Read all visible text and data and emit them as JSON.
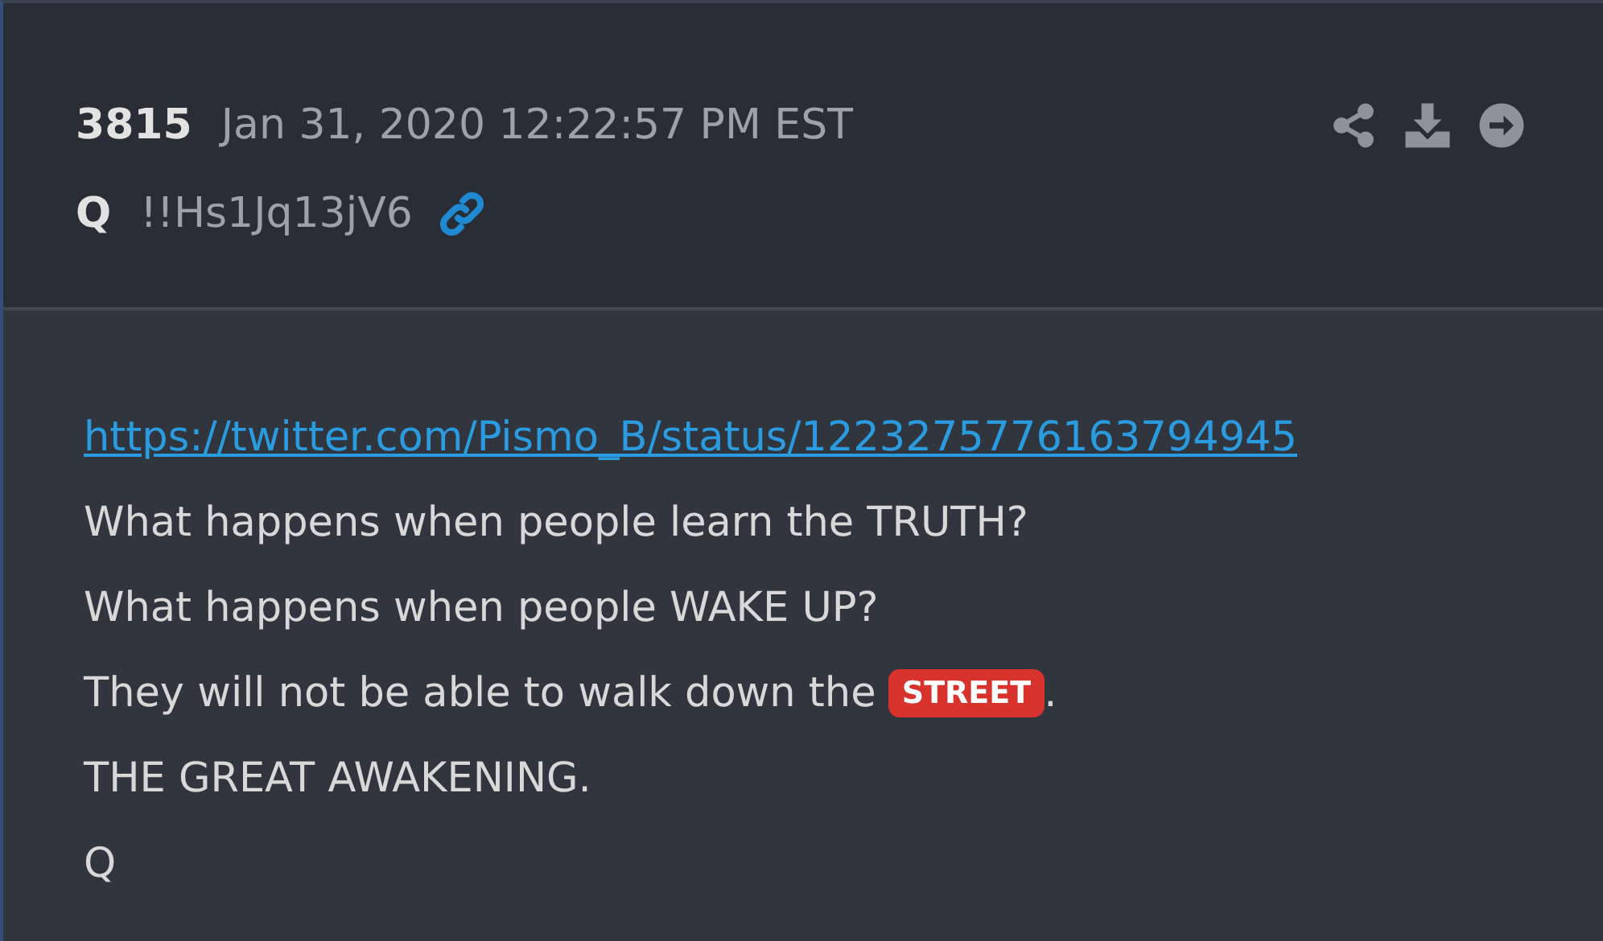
{
  "post": {
    "number": "3815",
    "date": "Jan 31, 2020 12:22:57 PM EST",
    "author": "Q",
    "tripcode": "!!Hs1Jq13jV6",
    "actions": [
      {
        "kind": "share"
      },
      {
        "kind": "download"
      },
      {
        "kind": "open"
      }
    ],
    "lines": [
      {
        "parts": [
          {
            "kind": "link",
            "text": "https://twitter.com/Pismo_B/status/1223275776163794945"
          }
        ]
      },
      {
        "parts": [
          {
            "kind": "text",
            "text": "What happens when people learn the TRUTH?"
          }
        ]
      },
      {
        "parts": [
          {
            "kind": "text",
            "text": "What happens when people WAKE UP?"
          }
        ]
      },
      {
        "parts": [
          {
            "kind": "text",
            "text": "They will not be able to walk down the "
          },
          {
            "kind": "tag",
            "text": "STREET"
          },
          {
            "kind": "text",
            "text": "."
          }
        ]
      },
      {
        "parts": [
          {
            "kind": "text",
            "text": "THE GREAT AWAKENING."
          }
        ]
      },
      {
        "parts": [
          {
            "kind": "text",
            "text": "Q"
          }
        ]
      }
    ]
  }
}
